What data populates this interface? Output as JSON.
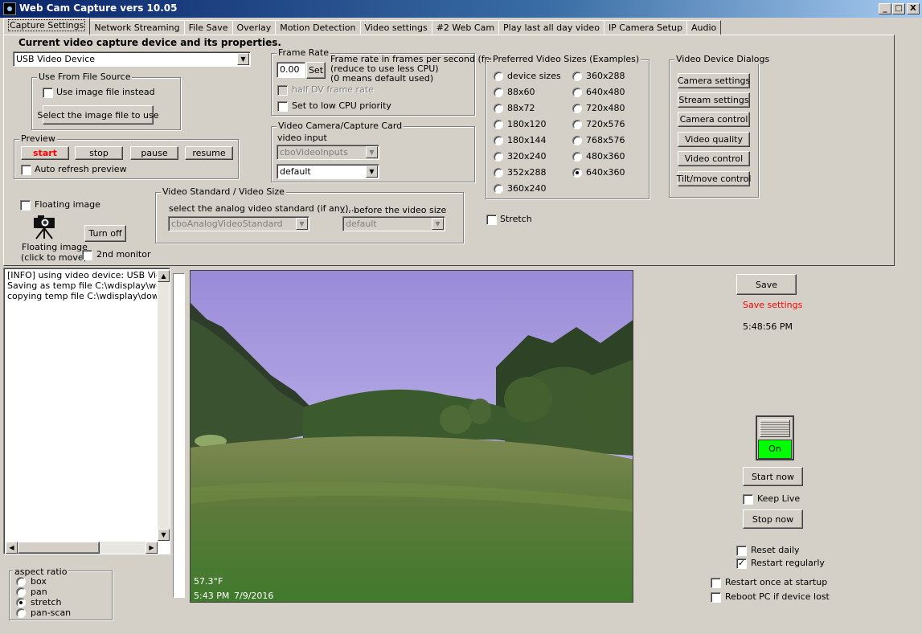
{
  "window": {
    "title": "Web Cam Capture vers 10.05",
    "controls": {
      "minimize": "_",
      "maximize": "□",
      "close": "X"
    }
  },
  "tabs": [
    "Capture Settings",
    "Network Streaming",
    "File Save",
    "Overlay",
    "Motion Detection",
    "Video settings",
    "#2 Web Cam",
    "Play last all day video",
    "IP Camera Setup",
    "Audio"
  ],
  "capture": {
    "heading": "Current video capture device and its properties.",
    "device": "USB Video Device",
    "file_source": {
      "title": "Use From File Source",
      "use_image_label": "Use image file instead",
      "select_button": "Select the image file to use"
    },
    "preview": {
      "title": "Preview",
      "start": "start",
      "stop": "stop",
      "pause": "pause",
      "resume": "resume",
      "auto_refresh": "Auto refresh preview"
    },
    "floating": {
      "checkbox_label": "Floating image",
      "caption_line1": "Floating image",
      "caption_line2": "(click to move)",
      "turn_off": "Turn off",
      "second_monitor": "2nd monitor"
    },
    "frame_rate": {
      "title": "Frame Rate",
      "value": "0.00",
      "set_button": "Set",
      "desc1": "Frame rate in frames per second (fps)",
      "desc2": "(reduce to use less CPU)",
      "desc3": "(0 means default used)",
      "half_dv": "half DV frame rate",
      "low_cpu": "Set to low CPU priority"
    },
    "capture_card": {
      "title": "Video Camera/Capture Card",
      "video_input_label": "video input",
      "inputs": "cboVideoInputs",
      "default": "default"
    },
    "video_standard": {
      "title": "Video Standard / Video Size",
      "select_label": "select the analog video standard (if any)...",
      "before_label": "... before the video size",
      "standard": "cboAnalogVideoStandard",
      "size": "default"
    },
    "sizes": {
      "title": "Preferred Video Sizes (Examples)",
      "left": [
        "device sizes",
        "88x60",
        "88x72",
        "180x120",
        "180x144",
        "320x240",
        "352x288",
        "360x240"
      ],
      "right": [
        "360x288",
        "640x480",
        "720x480",
        "720x576",
        "768x576",
        "480x360",
        "640x360"
      ],
      "selected": "640x360",
      "stretch": "Stretch"
    },
    "dialogs": {
      "title": "Video Device Dialogs",
      "buttons": [
        "Camera settings",
        "Stream settings",
        "Camera control",
        "Video quality",
        "Video control",
        "Tilt/move control"
      ]
    }
  },
  "log": {
    "lines": [
      "[INFO] using video device: USB Video",
      "Saving as temp file C:\\wdisplay\\webfi",
      "copying temp file C:\\wdisplay\\downlo"
    ]
  },
  "aspect": {
    "title": "aspect ratio",
    "options": [
      "box",
      "pan",
      "stretch",
      "pan-scan"
    ],
    "selected": "stretch"
  },
  "video_overlay": {
    "temp": "57.3°F",
    "time": "5:43 PM",
    "date": "7/9/2016"
  },
  "right_panel": {
    "save": "Save",
    "save_settings": "Save settings",
    "clock": "5:48:56 PM",
    "toggle": "On",
    "toggle_color": "#00ff00",
    "start_now": "Start now",
    "keep_live": "Keep Live",
    "stop_now": "Stop now",
    "reset_daily": "Reset daily",
    "restart_regularly": "Restart regularly",
    "restart_once": "Restart once at startup",
    "reboot_pc": "Reboot PC if device lost"
  },
  "colors": {
    "face": "#d4d0c8",
    "title_bar": "#0a246a",
    "warn_text": "#ff0000"
  }
}
